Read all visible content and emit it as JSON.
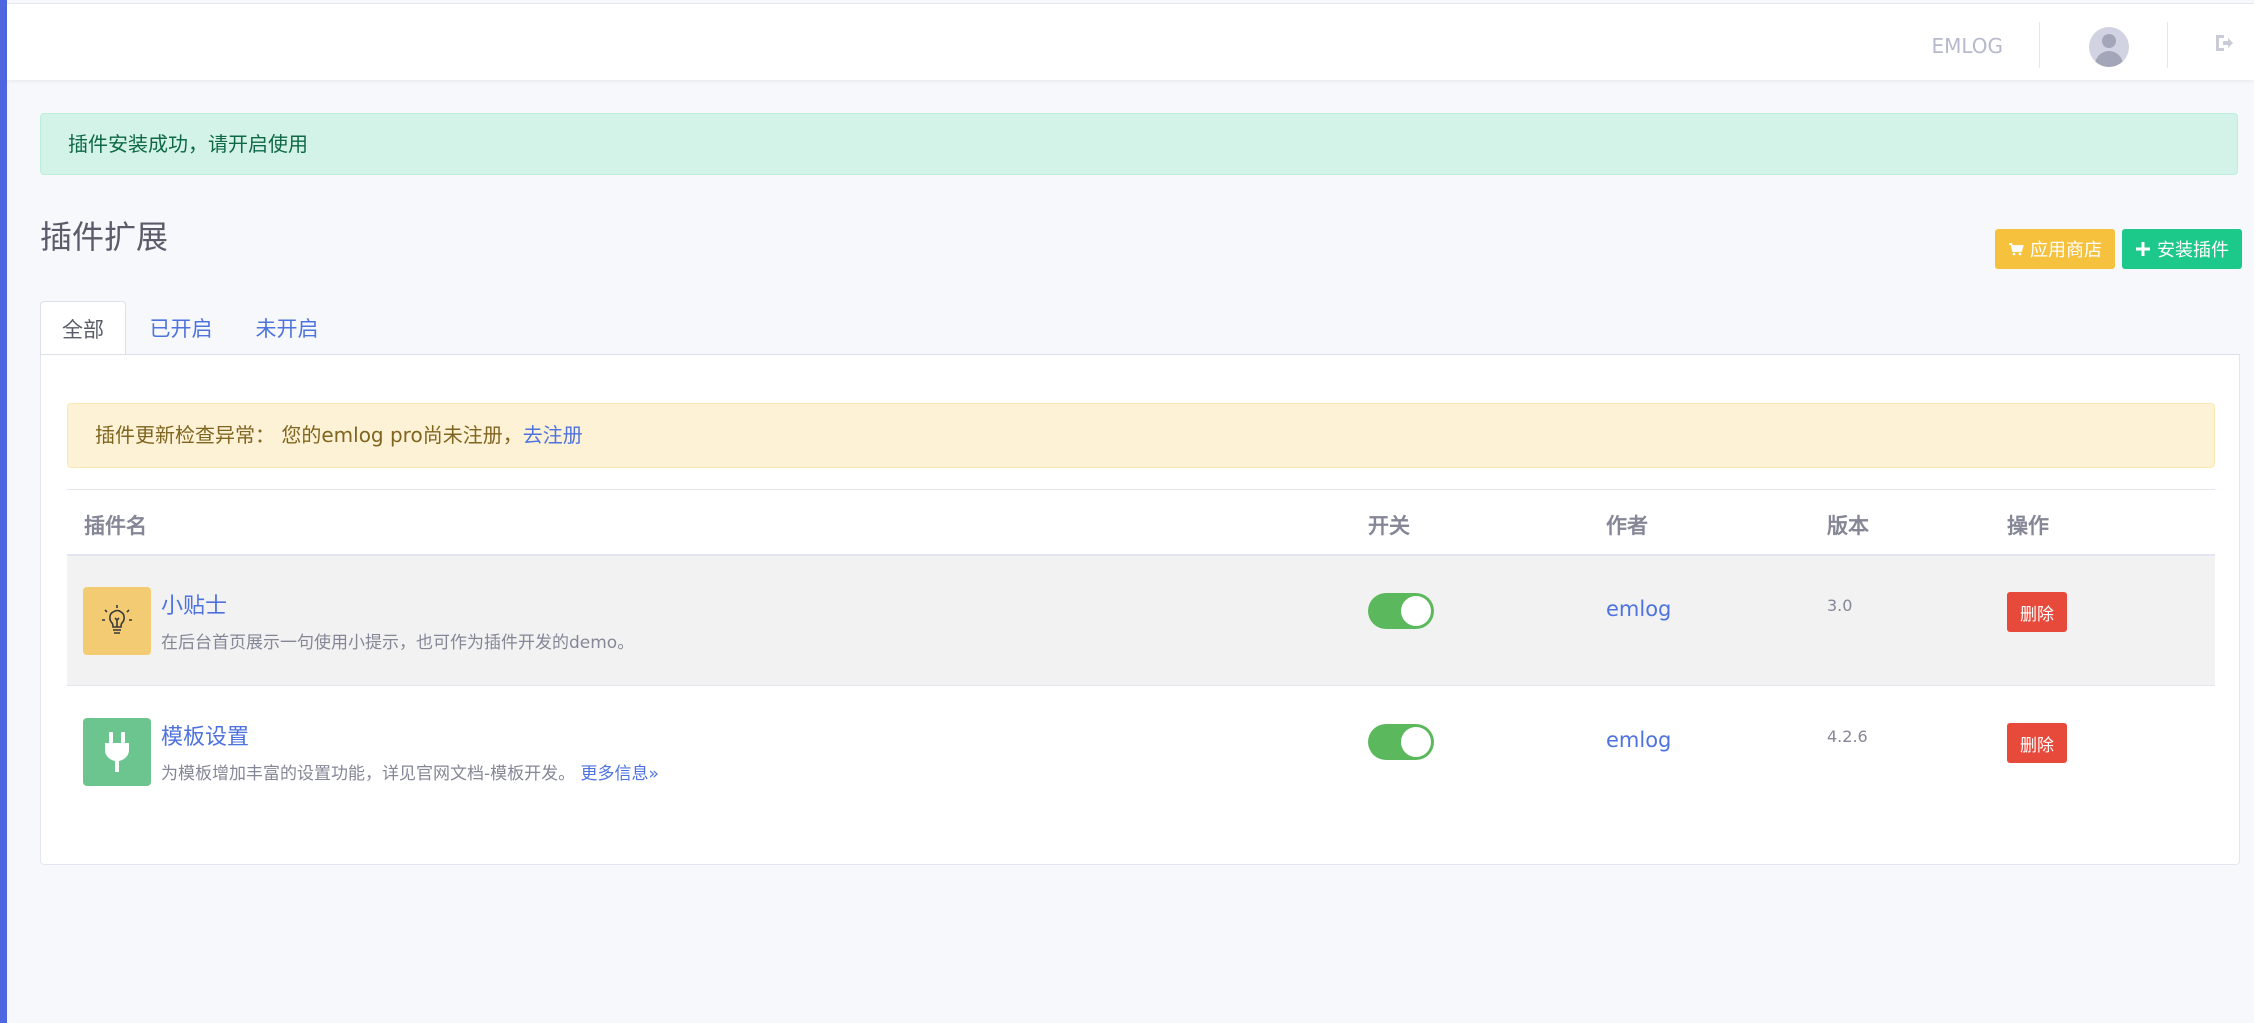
{
  "topbar": {
    "brand": "EMLOG",
    "avatar_icon": "user-avatar-icon",
    "logout_icon": "sign-out-icon"
  },
  "alert_success": "插件安装成功，请开启使用",
  "page": {
    "title": "插件扩展",
    "store_button": "应用商店",
    "install_button": "安装插件"
  },
  "tabs": [
    {
      "label": "全部",
      "active": true
    },
    {
      "label": "已开启",
      "active": false
    },
    {
      "label": "未开启",
      "active": false
    }
  ],
  "alert_warning": {
    "text": "插件更新检查异常： 您的emlog pro尚未注册，",
    "link": "去注册"
  },
  "table": {
    "headers": {
      "name": "插件名",
      "switch": "开关",
      "author": "作者",
      "version": "版本",
      "action": "操作"
    },
    "rows": [
      {
        "name": "小贴士",
        "description": "在后台首页展示一句使用小提示，也可作为插件开发的demo。",
        "more": "",
        "enabled": true,
        "author": "emlog",
        "version": "3.0",
        "delete_label": "删除",
        "icon": "lightbulb-icon",
        "icon_color": "#f3cb73"
      },
      {
        "name": "模板设置",
        "description": "为模板增加丰富的设置功能，详见官网文档-模板开发。",
        "more": "更多信息»",
        "enabled": true,
        "author": "emlog",
        "version": "4.2.6",
        "delete_label": "删除",
        "icon": "plug-icon",
        "icon_color": "#6cc58e"
      }
    ]
  },
  "colors": {
    "primary": "#4e73df",
    "success": "#1cc88a",
    "warning": "#f6c23e",
    "danger": "#e74a3b",
    "toggle_on": "#5cb85c"
  }
}
